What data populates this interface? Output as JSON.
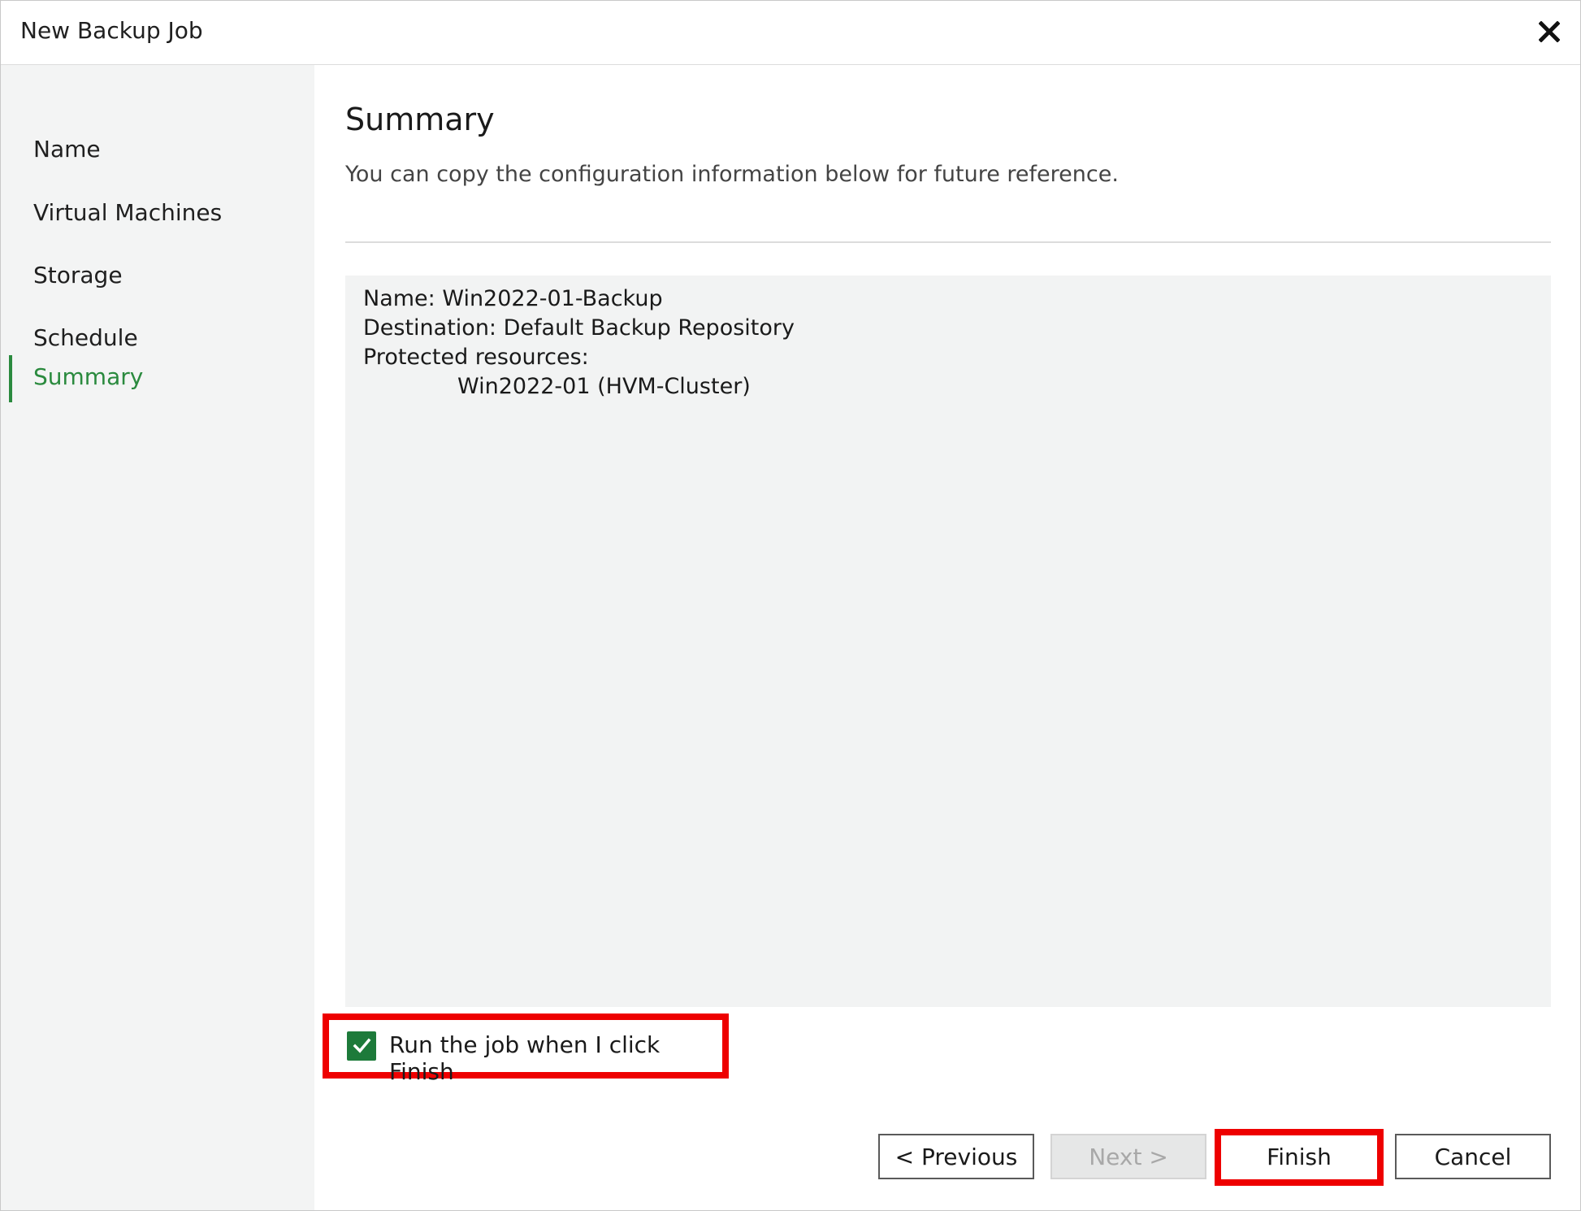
{
  "window": {
    "title": "New Backup Job"
  },
  "sidebar": {
    "items": [
      {
        "label": "Name",
        "active": false
      },
      {
        "label": "Virtual Machines",
        "active": false
      },
      {
        "label": "Storage",
        "active": false
      },
      {
        "label": "Schedule",
        "active": false
      },
      {
        "label": "Summary",
        "active": true
      }
    ]
  },
  "main": {
    "title": "Summary",
    "description": "You can copy the configuration information below for future reference.",
    "summary_lines": [
      "Name: Win2022-01-Backup",
      "Destination: Default Backup Repository",
      "Protected resources:",
      "Win2022-01 (HVM-Cluster)"
    ],
    "run_job_checkbox": {
      "label": "Run the job when I click Finish",
      "checked": true
    }
  },
  "buttons": {
    "previous": "< Previous",
    "next": "Next >",
    "finish": "Finish",
    "cancel": "Cancel"
  },
  "icons": {
    "close": "close-icon",
    "check": "checkmark-icon"
  },
  "colors": {
    "accent": "#2a8a3e",
    "checkbox": "#1d7a3a",
    "highlight": "#ee0000",
    "summary_bg": "#f2f3f3",
    "sidebar_bg": "#f3f4f4"
  }
}
